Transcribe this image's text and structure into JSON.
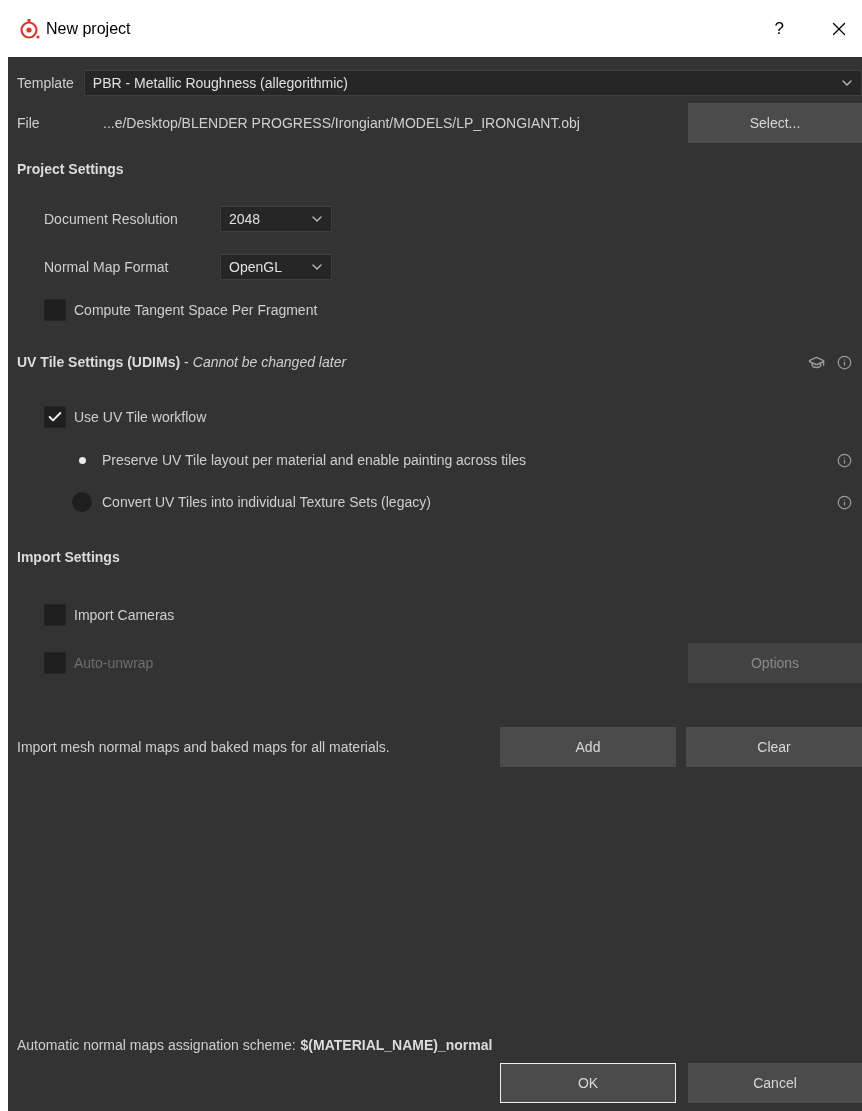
{
  "window": {
    "title": "New project",
    "help": "?"
  },
  "template": {
    "label": "Template",
    "value": "PBR - Metallic Roughness (allegorithmic)"
  },
  "file": {
    "label": "File",
    "value": "...e/Desktop/BLENDER PROGRESS/Irongiant/MODELS/LP_IRONGIANT.obj",
    "button": "Select..."
  },
  "project_settings": {
    "title": "Project Settings",
    "dropdowns": [
      {
        "label": "Document Resolution",
        "value": "2048"
      },
      {
        "label": "Normal Map Format",
        "value": "OpenGL"
      }
    ],
    "compute_tangent": {
      "label": "Compute Tangent Space Per Fragment",
      "checked": false
    }
  },
  "uv_tile_settings": {
    "title": "UV Tile Settings (UDIMs)",
    "separator": "-",
    "note": "Cannot be changed later",
    "use_workflow": {
      "label": "Use UV Tile workflow",
      "checked": true
    },
    "options": [
      {
        "label": "Preserve UV Tile layout per material and enable painting across tiles",
        "selected": true
      },
      {
        "label": "Convert UV Tiles into individual Texture Sets (legacy)",
        "selected": false
      }
    ]
  },
  "import_settings": {
    "title": "Import Settings",
    "import_cameras": {
      "label": "Import Cameras",
      "checked": false,
      "disabled": false
    },
    "auto_unwrap": {
      "label": "Auto-unwrap",
      "checked": false,
      "disabled": true
    },
    "options_button": {
      "label": "Options",
      "disabled": true
    },
    "mesh_maps": {
      "text": "Import mesh normal maps and baked maps for all materials.",
      "buttons": [
        "Add",
        "Clear"
      ]
    }
  },
  "scheme": {
    "label": "Automatic normal maps assignation scheme:",
    "value": "$(MATERIAL_NAME)_normal"
  },
  "buttons": [
    {
      "label": "OK",
      "default": true
    },
    {
      "label": "Cancel",
      "default": false
    }
  ]
}
